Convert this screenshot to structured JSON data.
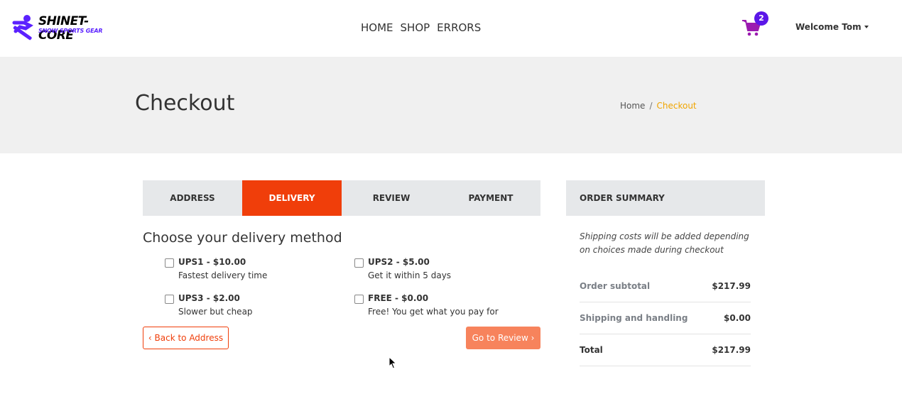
{
  "brand": {
    "name": "SHINET-CORE",
    "tagline": "SNOW SPORTS GEAR",
    "accent": "#5b21ff"
  },
  "nav": {
    "items": [
      "HOME",
      "SHOP",
      "ERRORS"
    ]
  },
  "header": {
    "cart_count": "2",
    "welcome": "Welcome Tom"
  },
  "hero": {
    "title": "Checkout",
    "breadcrumb": {
      "home": "Home",
      "sep": "/",
      "current": "Checkout"
    }
  },
  "steps": {
    "items": [
      "ADDRESS",
      "DELIVERY",
      "REVIEW",
      "PAYMENT"
    ],
    "active_index": 1
  },
  "delivery": {
    "title": "Choose your delivery method",
    "options": [
      {
        "name": "UPS1 - $10.00",
        "desc": "Fastest delivery time",
        "checked": false
      },
      {
        "name": "UPS2 - $5.00",
        "desc": "Get it within 5 days",
        "checked": false
      },
      {
        "name": "UPS3 - $2.00",
        "desc": "Slower but cheap",
        "checked": false
      },
      {
        "name": "FREE - $0.00",
        "desc": "Free! You get what you pay for",
        "checked": false
      }
    ],
    "back_label": "‹ Back to Address",
    "next_label": "Go to Review ›"
  },
  "summary": {
    "title": "ORDER SUMMARY",
    "note": "Shipping costs will be added depending on choices made during checkout",
    "rows": [
      {
        "label": "Order subtotal",
        "value": "$217.99"
      },
      {
        "label": "Shipping and handling",
        "value": "$0.00"
      },
      {
        "label": "Total",
        "value": "$217.99"
      }
    ]
  },
  "colors": {
    "primary": "#f03e0a",
    "primary_light": "#f7835c",
    "breadcrumb_active": "#f0a500",
    "badge": "#5b16e8",
    "cart_icon": "#9b1bb0"
  }
}
